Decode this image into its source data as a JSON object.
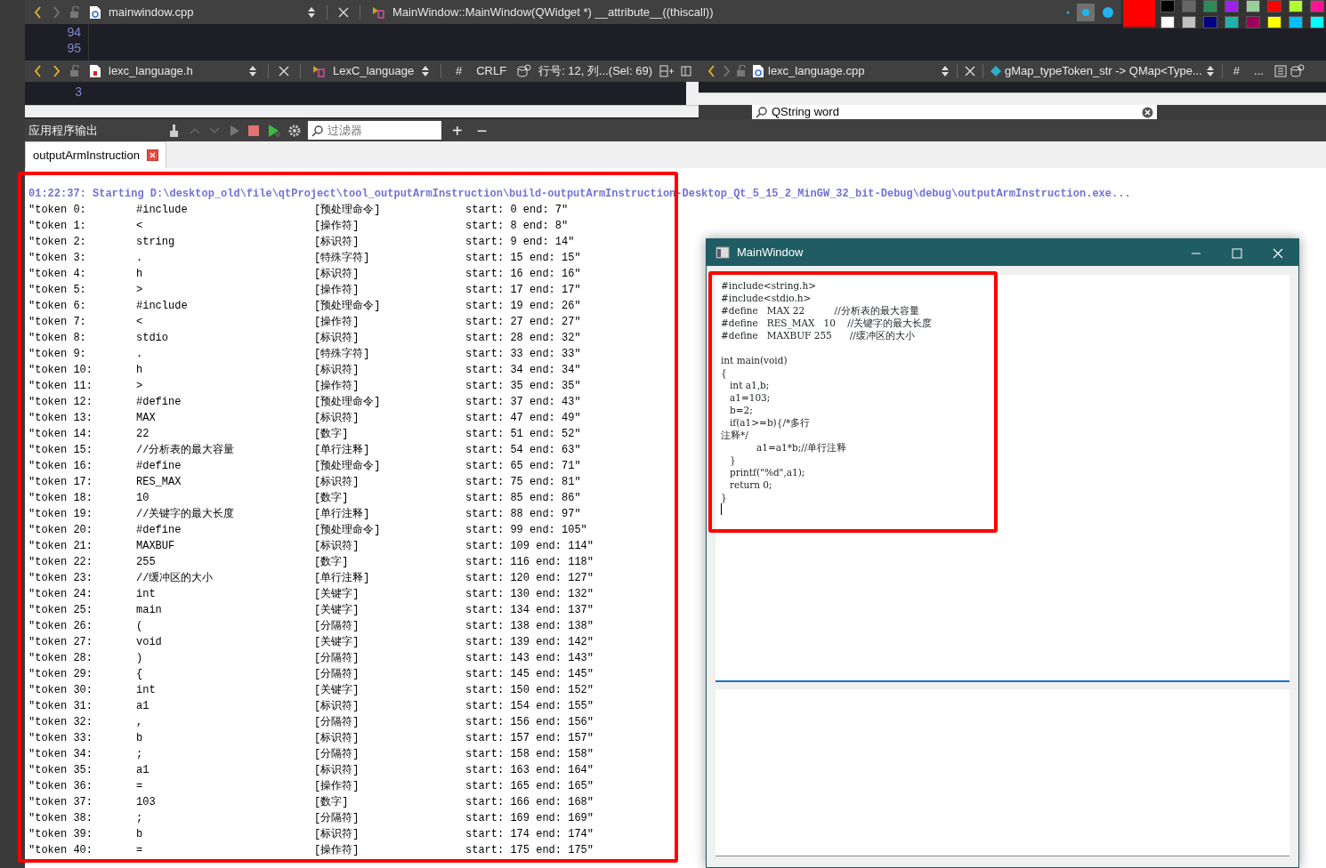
{
  "editor_top": {
    "nav": {
      "back_disabled": false,
      "forward_disabled": true
    },
    "file": "mainwindow.cpp",
    "symbol": "MainWindow::MainWindow(QWidget *) __attribute__((thiscall))",
    "line_numbers": [
      "94",
      "95"
    ]
  },
  "editor_left": {
    "nav": {
      "back_disabled": false,
      "forward_disabled": false
    },
    "file": "lexc_language.h",
    "symbol": "LexC_language",
    "hash": "#",
    "line_ending": "CRLF",
    "position": "行号: 12, 列...(Sel: 69)",
    "line_numbers": [
      "3"
    ]
  },
  "editor_right": {
    "nav": {
      "back_disabled": false,
      "forward_disabled": true
    },
    "file": "lexc_language.cpp",
    "symbol": "gMap_typeToken_str -> QMap<Type...",
    "hash": "#",
    "more": "...",
    "find_value": "QString word"
  },
  "color_palette": [
    {
      "color": "#ff0000"
    },
    {
      "color": "#000000"
    },
    {
      "color": "#666666"
    },
    {
      "color": "#2e8b57"
    },
    {
      "color": "#a020f0"
    },
    {
      "color": "#98d098"
    },
    {
      "color": "#ff0000"
    },
    {
      "color": "#adff2f"
    },
    {
      "color": "#ff1493"
    },
    {
      "color": "#ffffff"
    },
    {
      "color": "#c0c0c0"
    },
    {
      "color": "#000080"
    },
    {
      "color": "#20b2aa"
    },
    {
      "color": "#a0005a"
    },
    {
      "color": "#ffff00"
    },
    {
      "color": "#00bfff"
    },
    {
      "color": "#00ffff"
    }
  ],
  "output_pane": {
    "title": "应用程序输出",
    "filter_placeholder": "过滤器",
    "add": "+",
    "remove": "−",
    "tabs": [
      {
        "label": "outputArmInstruction",
        "selected": true
      }
    ],
    "start_line": "01:22:37: Starting D:\\desktop_old\\file\\qtProject\\tool_outputArmInstruction\\build-outputArmInstruction-Desktop_Qt_5_15_2_MinGW_32_bit-Debug\\debug\\outputArmInstruction.exe...",
    "tokens": [
      {
        "label": "\"token 0:",
        "value": "#include",
        "category": "[预处理命令]",
        "range": "start: 0  end: 7\""
      },
      {
        "label": "\"token 1:",
        "value": "<",
        "category": "[操作符]",
        "range": "start: 8  end: 8\""
      },
      {
        "label": "\"token 2:",
        "value": "string",
        "category": "[标识符]",
        "range": "start: 9  end: 14\""
      },
      {
        "label": "\"token 3:",
        "value": ".",
        "category": "[特殊字符]",
        "range": "start: 15  end: 15\""
      },
      {
        "label": "\"token 4:",
        "value": "h",
        "category": "[标识符]",
        "range": "start: 16  end: 16\""
      },
      {
        "label": "\"token 5:",
        "value": ">",
        "category": "[操作符]",
        "range": "start: 17  end: 17\""
      },
      {
        "label": "\"token 6:",
        "value": "#include",
        "category": "[预处理命令]",
        "range": "start: 19  end: 26\""
      },
      {
        "label": "\"token 7:",
        "value": "<",
        "category": "[操作符]",
        "range": "start: 27  end: 27\""
      },
      {
        "label": "\"token 8:",
        "value": "stdio",
        "category": "[标识符]",
        "range": "start: 28  end: 32\""
      },
      {
        "label": "\"token 9:",
        "value": ".",
        "category": "[特殊字符]",
        "range": "start: 33  end: 33\""
      },
      {
        "label": "\"token 10:",
        "value": "h",
        "category": "[标识符]",
        "range": "start: 34  end: 34\""
      },
      {
        "label": "\"token 11:",
        "value": ">",
        "category": "[操作符]",
        "range": "start: 35  end: 35\""
      },
      {
        "label": "\"token 12:",
        "value": "#define",
        "category": "[预处理命令]",
        "range": "start: 37  end: 43\""
      },
      {
        "label": "\"token 13:",
        "value": "MAX",
        "category": "[标识符]",
        "range": "start: 47  end: 49\""
      },
      {
        "label": "\"token 14:",
        "value": "22",
        "category": "[数字]",
        "range": "start: 51  end: 52\""
      },
      {
        "label": "\"token 15:",
        "value": "//分析表的最大容量",
        "category": "[单行注释]",
        "range": "start: 54  end: 63\""
      },
      {
        "label": "\"token 16:",
        "value": "#define",
        "category": "[预处理命令]",
        "range": "start: 65  end: 71\""
      },
      {
        "label": "\"token 17:",
        "value": "RES_MAX",
        "category": "[标识符]",
        "range": "start: 75  end: 81\""
      },
      {
        "label": "\"token 18:",
        "value": "10",
        "category": "[数字]",
        "range": "start: 85  end: 86\""
      },
      {
        "label": "\"token 19:",
        "value": "//关键字的最大长度",
        "category": "[单行注释]",
        "range": "start: 88  end: 97\""
      },
      {
        "label": "\"token 20:",
        "value": "#define",
        "category": "[预处理命令]",
        "range": "start: 99  end: 105\""
      },
      {
        "label": "\"token 21:",
        "value": "MAXBUF",
        "category": "[标识符]",
        "range": "start: 109  end: 114\""
      },
      {
        "label": "\"token 22:",
        "value": "255",
        "category": "[数字]",
        "range": "start: 116  end: 118\""
      },
      {
        "label": "\"token 23:",
        "value": "//缓冲区的大小",
        "category": "[单行注释]",
        "range": "start: 120  end: 127\""
      },
      {
        "label": "\"token 24:",
        "value": "int",
        "category": "[关键字]",
        "range": "start: 130  end: 132\""
      },
      {
        "label": "\"token 25:",
        "value": "main",
        "category": "[关键字]",
        "range": "start: 134  end: 137\""
      },
      {
        "label": "\"token 26:",
        "value": "(",
        "category": "[分隔符]",
        "range": "start: 138  end: 138\""
      },
      {
        "label": "\"token 27:",
        "value": "void",
        "category": "[关键字]",
        "range": "start: 139  end: 142\""
      },
      {
        "label": "\"token 28:",
        "value": ")",
        "category": "[分隔符]",
        "range": "start: 143  end: 143\""
      },
      {
        "label": "\"token 29:",
        "value": "{",
        "category": "[分隔符]",
        "range": "start: 145  end: 145\""
      },
      {
        "label": "\"token 30:",
        "value": "int",
        "category": "[关键字]",
        "range": "start: 150  end: 152\""
      },
      {
        "label": "\"token 31:",
        "value": "a1",
        "category": "[标识符]",
        "range": "start: 154  end: 155\""
      },
      {
        "label": "\"token 32:",
        "value": ",",
        "category": "[分隔符]",
        "range": "start: 156  end: 156\""
      },
      {
        "label": "\"token 33:",
        "value": "b",
        "category": "[标识符]",
        "range": "start: 157  end: 157\""
      },
      {
        "label": "\"token 34:",
        "value": ";",
        "category": "[分隔符]",
        "range": "start: 158  end: 158\""
      },
      {
        "label": "\"token 35:",
        "value": "a1",
        "category": "[标识符]",
        "range": "start: 163  end: 164\""
      },
      {
        "label": "\"token 36:",
        "value": "=",
        "category": "[操作符]",
        "range": "start: 165  end: 165\""
      },
      {
        "label": "\"token 37:",
        "value": "103",
        "category": "[数字]",
        "range": "start: 166  end: 168\""
      },
      {
        "label": "\"token 38:",
        "value": ";",
        "category": "[分隔符]",
        "range": "start: 169  end: 169\""
      },
      {
        "label": "\"token 39:",
        "value": "b",
        "category": "[标识符]",
        "range": "start: 174  end: 174\""
      },
      {
        "label": "\"token 40:",
        "value": "=",
        "category": "[操作符]",
        "range": "start: 175  end: 175\""
      }
    ]
  },
  "app_window": {
    "title": "MainWindow",
    "code_blocks": [
      [
        "#include<string.h>",
        "#include<stdio.h>",
        "#define   MAX 22          //分析表的最大容量",
        "#define   RES_MAX   10    //关键字的最大长度",
        "#define   MAXBUF 255      //缓冲区的大小"
      ],
      [
        "int main(void)",
        "{",
        "   int a1,b;",
        "   a1=103;",
        "   b=2;",
        "   if(a1>=b){/*多行",
        "注释*/",
        "            a1=a1*b;//单行注释",
        "   }",
        "   printf(\"%d\",a1);",
        "   return 0;",
        "}"
      ]
    ]
  }
}
